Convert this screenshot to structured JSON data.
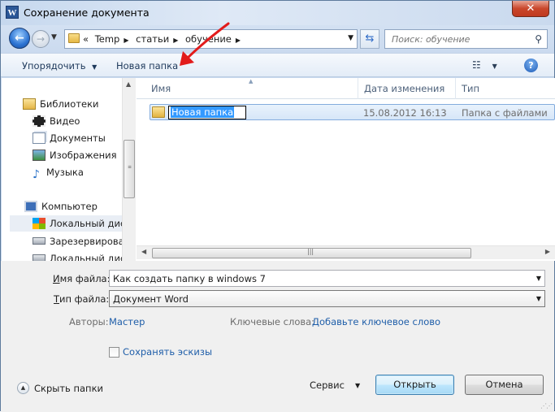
{
  "window": {
    "title": "Сохранение документа",
    "app_icon": "W",
    "close_glyph": "✕"
  },
  "nav": {
    "breadcrumbs": [
      "Temp",
      "статьи",
      "обучение"
    ],
    "prefix": "«",
    "search_placeholder": "Поиск: обучение"
  },
  "toolbar": {
    "organize": "Упорядочить",
    "new_folder": "Новая папка",
    "help": "?"
  },
  "navpane": {
    "items": [
      {
        "label": "Библиотеки",
        "icon": "library-icon"
      },
      {
        "label": "Видео",
        "icon": "video-icon"
      },
      {
        "label": "Документы",
        "icon": "documents-icon"
      },
      {
        "label": "Изображения",
        "icon": "pictures-icon"
      },
      {
        "label": "Музыка",
        "icon": "music-icon"
      },
      {
        "label": "Компьютер",
        "icon": "computer-icon"
      },
      {
        "label": "Локальный диск",
        "icon": "windows-drive-icon"
      },
      {
        "label": "Зарезервирован",
        "icon": "drive-icon"
      },
      {
        "label": "Локальный диск",
        "icon": "drive-icon"
      }
    ]
  },
  "columns": {
    "name": "Имя",
    "date": "Дата изменения",
    "type": "Тип"
  },
  "rows": [
    {
      "name": "Новая папка",
      "date": "15.08.2012 16:13",
      "type": "Папка с файлами"
    }
  ],
  "form": {
    "filename_label_u": "И",
    "filename_label_rest": "мя файла:",
    "filename_value": "Как создать папку в windows 7",
    "filetype_label_u": "Т",
    "filetype_label_rest": "ип файла:",
    "filetype_value": "Документ Word",
    "authors_label": "Авторы:",
    "authors_value": "Мастер",
    "keywords_label": "Ключевые слова:",
    "keywords_value": "Добавьте ключевое слово",
    "thumbnails_label": "Сохранять эскизы",
    "hide_folders": "Скрыть папки",
    "service": "Сервис",
    "open": "Открыть",
    "cancel": "Отмена"
  },
  "colors": {
    "annotation_arrow": "#e21b1b",
    "link": "#1f5ea9",
    "selection": "#3399ff"
  }
}
